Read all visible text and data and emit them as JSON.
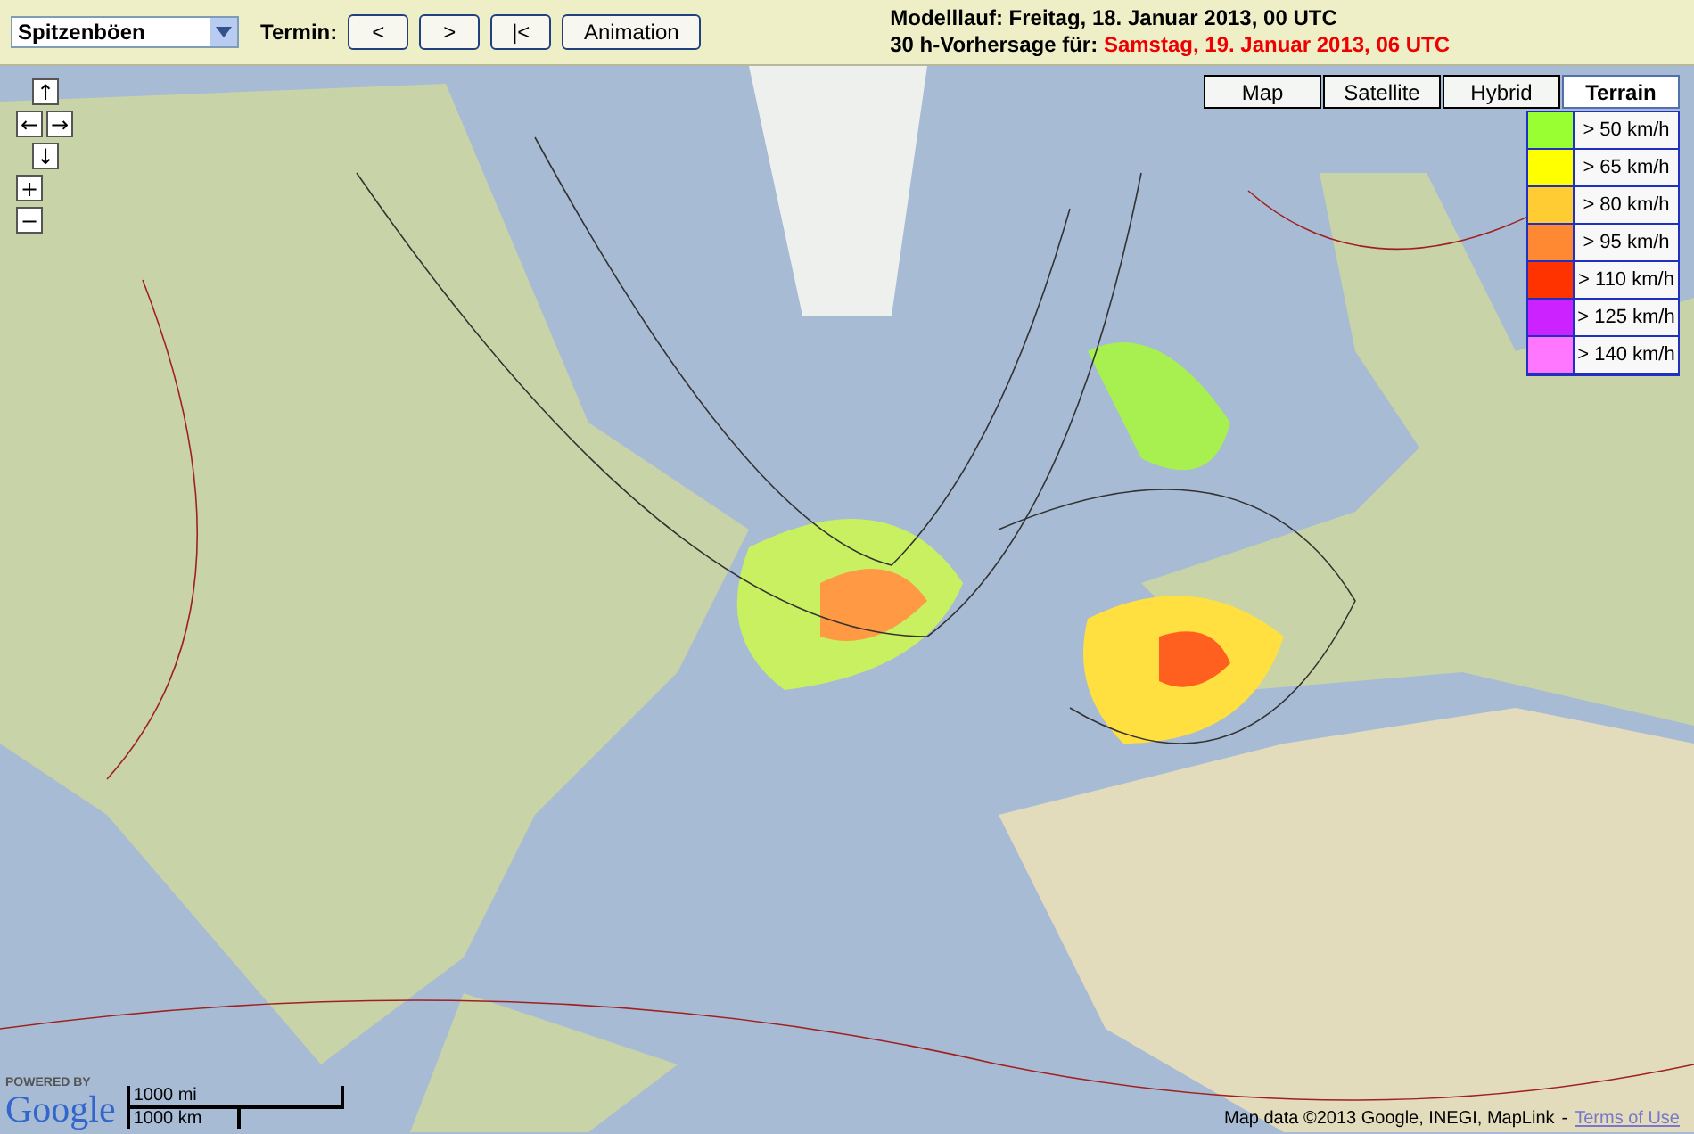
{
  "toolbar": {
    "parameter_select": {
      "value": "Spitzenböen"
    },
    "termin_label": "Termin:",
    "buttons": [
      {
        "label": "<"
      },
      {
        "label": ">"
      },
      {
        "label": "|<"
      },
      {
        "label": "Animation"
      }
    ],
    "model_run": "Modelllauf: Freitag, 18. Januar 2013, 00 UTC",
    "forecast_label": "30 h-Vorhersage für:",
    "forecast_time": "Samstag, 19. Januar 2013, 06 UTC"
  },
  "map": {
    "type_buttons": [
      {
        "label": "Map",
        "selected": false
      },
      {
        "label": "Satellite",
        "selected": false
      },
      {
        "label": "Hybrid",
        "selected": false
      },
      {
        "label": "Terrain",
        "selected": true
      }
    ],
    "legend": [
      {
        "label": "> 50 km/h",
        "color": "#99ff33"
      },
      {
        "label": "> 65 km/h",
        "color": "#ffff00"
      },
      {
        "label": "> 80 km/h",
        "color": "#ffcc33"
      },
      {
        "label": "> 95 km/h",
        "color": "#ff8833"
      },
      {
        "label": "> 110 km/h",
        "color": "#ff3300"
      },
      {
        "label": "> 125 km/h",
        "color": "#cc22ff"
      },
      {
        "label": "> 140 km/h",
        "color": "#ff77ff"
      }
    ],
    "pan_controls": {
      "up": "↑",
      "left": "←",
      "right": "→",
      "down": "↓"
    },
    "zoom_controls": {
      "in": "+",
      "out": "−"
    },
    "powered_by": "POWERED BY",
    "logo": "Google",
    "scale": {
      "miles": "1000 mi",
      "km": "1000 km"
    },
    "attribution": "Map data ©2013 Google, INEGI, MapLink",
    "terms_separator": "-",
    "terms_link": "Terms of Use"
  }
}
